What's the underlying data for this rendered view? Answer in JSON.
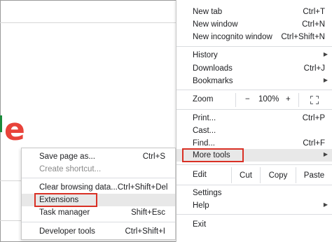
{
  "main_menu": {
    "new_tab": {
      "label": "New tab",
      "shortcut": "Ctrl+T"
    },
    "new_window": {
      "label": "New window",
      "shortcut": "Ctrl+N"
    },
    "new_incognito": {
      "label": "New incognito window",
      "shortcut": "Ctrl+Shift+N"
    },
    "history": {
      "label": "History"
    },
    "downloads": {
      "label": "Downloads",
      "shortcut": "Ctrl+J"
    },
    "bookmarks": {
      "label": "Bookmarks"
    },
    "zoom": {
      "label": "Zoom",
      "minus": "−",
      "value": "100%",
      "plus": "+"
    },
    "print": {
      "label": "Print...",
      "shortcut": "Ctrl+P"
    },
    "cast": {
      "label": "Cast..."
    },
    "find": {
      "label": "Find...",
      "shortcut": "Ctrl+F"
    },
    "more_tools": {
      "label": "More tools"
    },
    "edit": {
      "label": "Edit",
      "cut": "Cut",
      "copy": "Copy",
      "paste": "Paste"
    },
    "settings": {
      "label": "Settings"
    },
    "help": {
      "label": "Help"
    },
    "exit": {
      "label": "Exit"
    }
  },
  "submenu": {
    "save_page": {
      "label": "Save page as...",
      "shortcut": "Ctrl+S"
    },
    "create_shortcut": {
      "label": "Create shortcut..."
    },
    "clear_browsing": {
      "label": "Clear browsing data...",
      "shortcut": "Ctrl+Shift+Del"
    },
    "extensions": {
      "label": "Extensions"
    },
    "task_manager": {
      "label": "Task manager",
      "shortcut": "Shift+Esc"
    },
    "developer_tools": {
      "label": "Developer tools",
      "shortcut": "Ctrl+Shift+I"
    }
  },
  "icons": {
    "submenu_arrow": "▶",
    "logo": "e"
  },
  "colors": {
    "highlight_box": "#d93025",
    "logo": "#e8433a",
    "hover_bg": "#e8e8e8"
  }
}
